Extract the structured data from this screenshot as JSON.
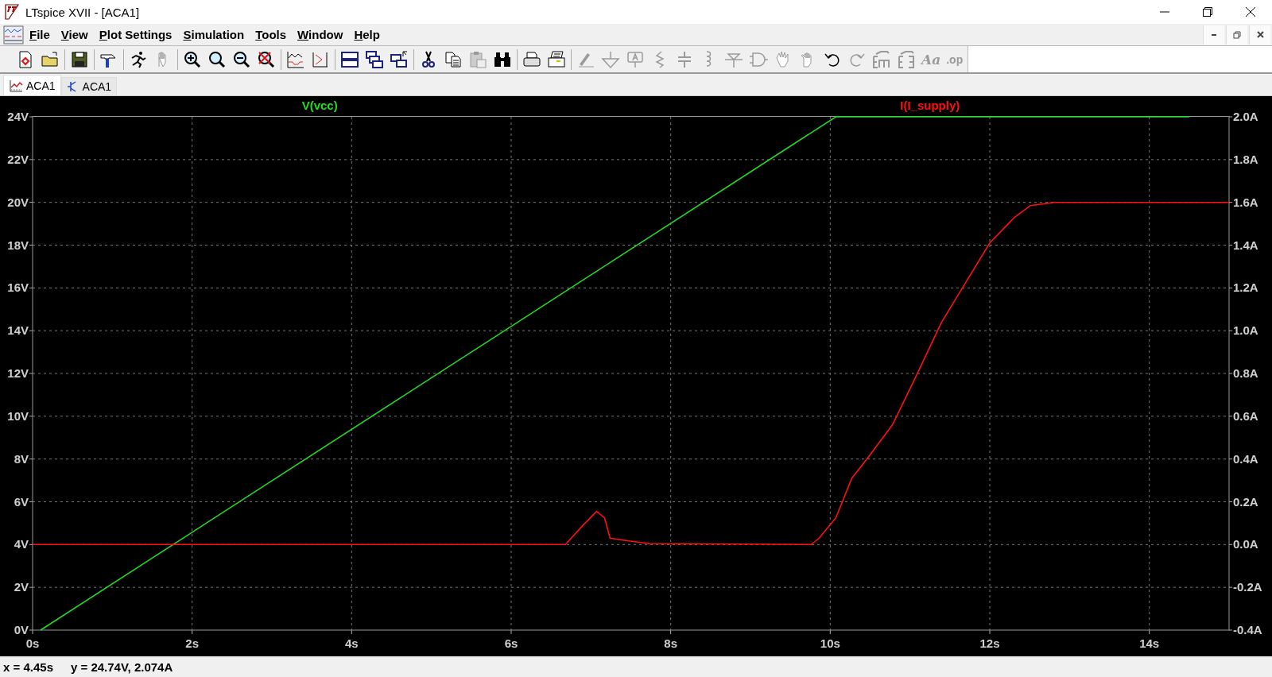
{
  "window": {
    "title": "LTspice XVII - [ACA1]"
  },
  "menu": [
    "File",
    "View",
    "Plot Settings",
    "Simulation",
    "Tools",
    "Window",
    "Help"
  ],
  "toolbar_groups": [
    [
      {
        "disabled": false
      },
      {
        "disabled": false
      }
    ],
    [
      {
        "disabled": false
      }
    ],
    [
      {
        "disabled": false
      }
    ],
    [
      {
        "disabled": false
      },
      {
        "disabled": true
      }
    ],
    [
      {
        "disabled": false
      },
      {
        "disabled": false
      },
      {
        "disabled": false
      },
      {
        "disabled": false
      }
    ],
    [
      {
        "disabled": false
      },
      {
        "disabled": false
      }
    ],
    [
      {
        "disabled": false
      },
      {
        "disabled": false
      },
      {
        "disabled": false
      }
    ],
    [
      {
        "disabled": false
      },
      {
        "disabled": false
      },
      {
        "disabled": true
      },
      {
        "disabled": false
      }
    ],
    [
      {
        "disabled": false
      },
      {
        "disabled": false
      }
    ],
    [
      {
        "disabled": true
      },
      {
        "disabled": true
      },
      {
        "disabled": true
      },
      {
        "disabled": true
      },
      {
        "disabled": true
      },
      {
        "disabled": true
      },
      {
        "disabled": true
      },
      {
        "disabled": true
      },
      {
        "disabled": true
      },
      {
        "disabled": true
      },
      {
        "disabled": false
      },
      {
        "disabled": true
      },
      {
        "disabled": true
      },
      {
        "disabled": true
      },
      {
        "disabled": true,
        "label": "Aa"
      },
      {
        "disabled": true,
        "label": ".op"
      }
    ]
  ],
  "tabs": [
    {
      "label": "ACA1",
      "kind": "waveform",
      "selected": true
    },
    {
      "label": "ACA1",
      "kind": "schematic",
      "selected": false
    }
  ],
  "plot": {
    "voltage_chart": {
      "chart_data": {
        "type": "line",
        "xlim": [
          0,
          15
        ],
        "ylim": [
          0,
          24
        ],
        "xticks": [
          {
            "value": 0,
            "label": "0s"
          },
          {
            "value": 2,
            "label": "2s"
          },
          {
            "value": 4,
            "label": "4s"
          },
          {
            "value": 6,
            "label": "6s"
          },
          {
            "value": 8,
            "label": "8s"
          },
          {
            "value": 10,
            "label": "10s"
          },
          {
            "value": 12,
            "label": "12s"
          },
          {
            "value": 14,
            "label": "14s"
          }
        ],
        "yticks": [
          {
            "value": 0,
            "label": "0V"
          },
          {
            "value": 2,
            "label": "2V"
          },
          {
            "value": 4,
            "label": "4V"
          },
          {
            "value": 6,
            "label": "6V"
          },
          {
            "value": 8,
            "label": "8V"
          },
          {
            "value": 10,
            "label": "10V"
          },
          {
            "value": 12,
            "label": "12V"
          },
          {
            "value": 14,
            "label": "14V"
          },
          {
            "value": 16,
            "label": "16V"
          },
          {
            "value": 18,
            "label": "18V"
          },
          {
            "value": 20,
            "label": "20V"
          },
          {
            "value": 22,
            "label": "22V"
          },
          {
            "value": 24,
            "label": "24V"
          }
        ],
        "grid": true,
        "x": [
          0.1,
          10.07,
          14.5
        ],
        "series": [
          {
            "name": "V(vcc)",
            "color": "#22dd22",
            "values": [
              0,
              24,
              24
            ]
          }
        ]
      }
    },
    "current_chart": {
      "chart_data": {
        "type": "line",
        "xlim": [
          0,
          15
        ],
        "ylim": [
          -0.4,
          2.0
        ],
        "yticks": [
          {
            "value": -0.4,
            "label": "-0.4A"
          },
          {
            "value": -0.2,
            "label": "-0.2A"
          },
          {
            "value": 0,
            "label": "0.0A"
          },
          {
            "value": 0.2,
            "label": "0.2A"
          },
          {
            "value": 0.4,
            "label": "0.4A"
          },
          {
            "value": 0.6,
            "label": "0.6A"
          },
          {
            "value": 0.8,
            "label": "0.8A"
          },
          {
            "value": 1.0,
            "label": "1.0A"
          },
          {
            "value": 1.2,
            "label": "1.2A"
          },
          {
            "value": 1.4,
            "label": "1.4A"
          },
          {
            "value": 1.6,
            "label": "1.6A"
          },
          {
            "value": 1.8,
            "label": "1.8A"
          },
          {
            "value": 2.0,
            "label": "2.0A"
          }
        ],
        "x": [
          0,
          6.68,
          6.9,
          7.07,
          7.17,
          7.24,
          7.42,
          7.73,
          9.76,
          9.86,
          10.07,
          10.27,
          10.48,
          10.78,
          11.08,
          11.39,
          11.69,
          12.0,
          12.31,
          12.51,
          12.81,
          15
        ],
        "series": [
          {
            "name": "I(I_supply)",
            "color": "#ff1010",
            "values": [
              0,
              0,
              0.09,
              0.155,
              0.125,
              0.03,
              0.02,
              0.005,
              0,
              0.03,
              0.125,
              0.31,
              0.41,
              0.56,
              0.79,
              1.035,
              1.22,
              1.41,
              1.53,
              1.585,
              1.6,
              1.6
            ]
          }
        ]
      }
    }
  },
  "status_bar": {
    "x_readout": "x = 4.45s",
    "y_readout": "y = 24.74V, 2.074A"
  }
}
